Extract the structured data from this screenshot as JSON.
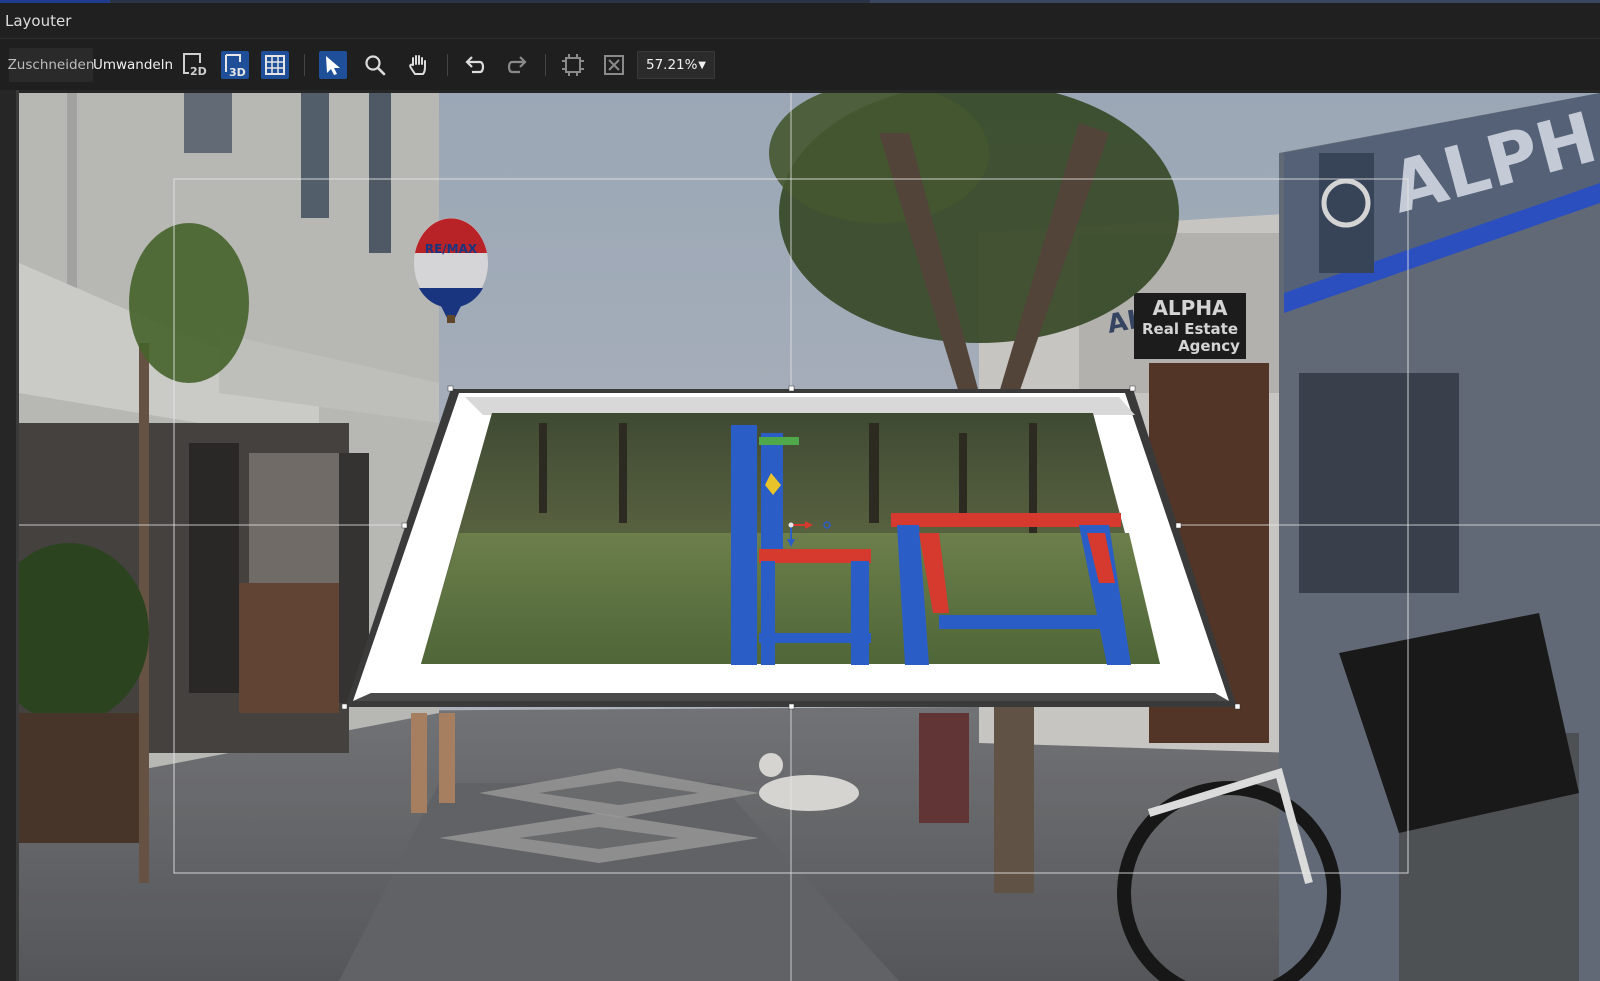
{
  "window": {
    "title": "Layouter"
  },
  "toolbar": {
    "tab_crop": "Zuschneiden",
    "tab_transform": "Umwandeln",
    "zoom": "57.21%",
    "icons": [
      "2d-mode-icon",
      "3d-mode-icon",
      "grid-icon",
      "select-arrow-icon",
      "zoom-icon",
      "pan-hand-icon",
      "undo-icon",
      "redo-icon",
      "fit-canvas-icon",
      "reset-size-icon"
    ]
  },
  "canvas": {
    "balloon_text": "RE/MAX",
    "shop_sign_line1": "ALPHA",
    "shop_sign_line2": "Real Estate",
    "shop_sign_line3": "Agency",
    "bank_lettering": "ALPHA",
    "balcony_lettering": "ALPHA"
  },
  "colors": {
    "accent": "#2f6fd6",
    "active_tool": "#1f4f99",
    "chair_blue": "#2b5dc7",
    "chair_red": "#d63a2f"
  }
}
